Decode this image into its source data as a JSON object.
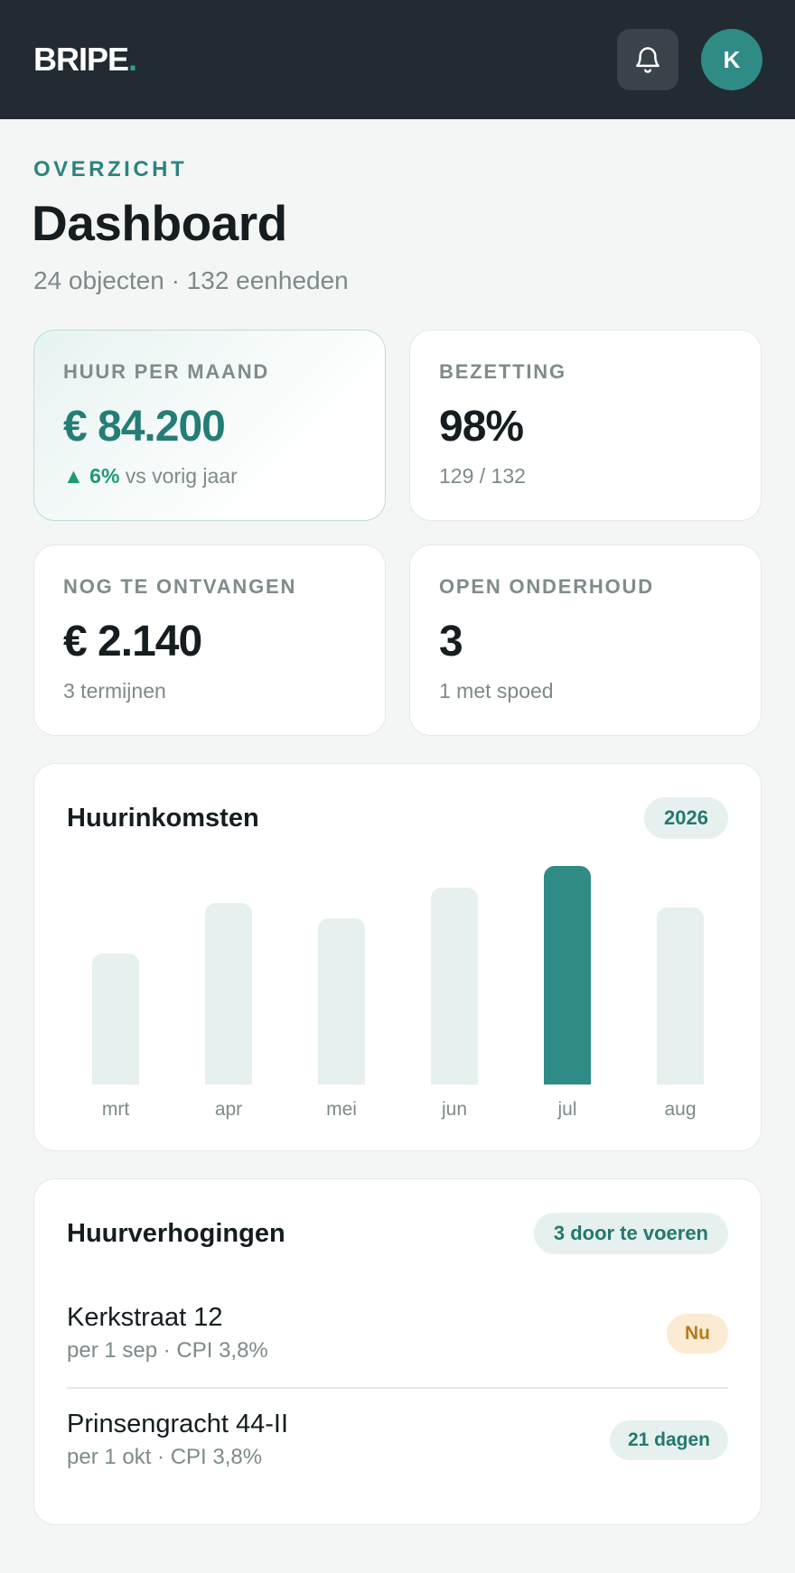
{
  "header": {
    "logo_text": "BRIPE",
    "logo_dot": ".",
    "bell_icon": "bell-icon",
    "avatar_initial": "K"
  },
  "page": {
    "eyebrow": "OVERZICHT",
    "title": "Dashboard",
    "subtitle": "24 objecten · 132 eenheden"
  },
  "kpis": [
    {
      "label": "HUUR PER MAAND",
      "value": "€ 84.200",
      "trend_icon": "▲",
      "trend": "6%",
      "sub": "vs vorig jaar"
    },
    {
      "label": "BEZETTING",
      "value": "98%",
      "sub": "129 / 132"
    },
    {
      "label": "NOG TE ONTVANGEN",
      "value": "€ 2.140",
      "sub": "3 termijnen"
    },
    {
      "label": "OPEN ONDERHOUD",
      "value": "3",
      "sub": "1 met spoed"
    }
  ],
  "income": {
    "title": "Huurinkomsten",
    "year": "2026",
    "active_color": "#2e8b86",
    "inactive_color": "#e6f0ee"
  },
  "chart_data": {
    "type": "bar",
    "categories": [
      "mrt",
      "apr",
      "mei",
      "jun",
      "jul",
      "aug"
    ],
    "values": [
      60,
      83,
      76,
      90,
      100,
      81
    ],
    "highlighted": "jul",
    "ylim": [
      0,
      100
    ],
    "grid": false
  },
  "increases": {
    "title": "Huurverhogingen",
    "count_label": "3 door te voeren",
    "items": [
      {
        "name": "Kerkstraat 12",
        "meta": "per 1 sep · CPI 3,8%",
        "badge": "Nu",
        "badge_type": "warn"
      },
      {
        "name": "Prinsengracht 44-II",
        "meta": "per 1 okt · CPI 3,8%",
        "badge": "21 dagen",
        "badge_type": "info"
      }
    ]
  },
  "colors": {
    "accent": "#2e8b86",
    "header_bg": "#212b31",
    "page_bg": "#f4f6f5",
    "trend_up": "#1f9a78",
    "warn": "#b67a1f"
  }
}
